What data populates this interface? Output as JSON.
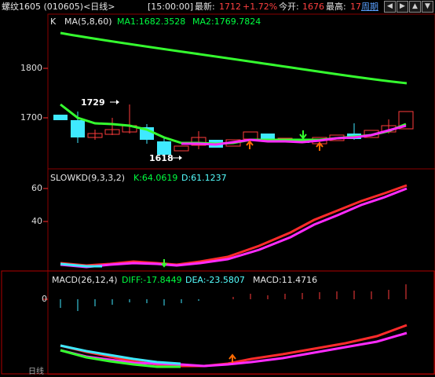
{
  "header": {
    "title": "螺纹1605 (010605)<日线>",
    "time": "[15:00:00]",
    "latest_label": "最新:",
    "latest_value": "1712",
    "change": "+1.72%",
    "open_label": "今开:",
    "open_value": "1676",
    "high_label": "最高:",
    "high_value": "17",
    "period_link": "周期"
  },
  "nav_icons": [
    "arrow-left-icon",
    "arrow-right-icon",
    "arrow-up-icon",
    "arrow-down-icon"
  ],
  "price_panel": {
    "title_k": "K",
    "ma_title": "MA(5,8,60)",
    "ma1": "MA1:1682.3528",
    "ma2": "MA2:1769.7824",
    "y_ticks": [
      "1800",
      "1700"
    ],
    "annotation_high": "1729",
    "annotation_low": "1618"
  },
  "kd_panel": {
    "title": "SLOWKD(9,3,3,2)",
    "k": "K:64.0619",
    "d": "D:61.1237",
    "y_ticks": [
      "60",
      "40"
    ]
  },
  "macd_panel": {
    "title": "MACD(26,12,4)",
    "diff": "DIFF:-17.8449",
    "dea": "DEA:-23.5807",
    "macd": "MACD:11.4716",
    "y_ticks": [
      "0"
    ]
  },
  "footer": {
    "label": "日线"
  },
  "colors": {
    "up": "#ff3b3b",
    "down": "#3fe9ff",
    "ma_green": "#35ff2f",
    "magenta": "#ff2bff",
    "grid": "#8b0000",
    "text_green": "#00ff40",
    "text_cyan": "#55ffff",
    "text_red": "#ff4040"
  }
}
